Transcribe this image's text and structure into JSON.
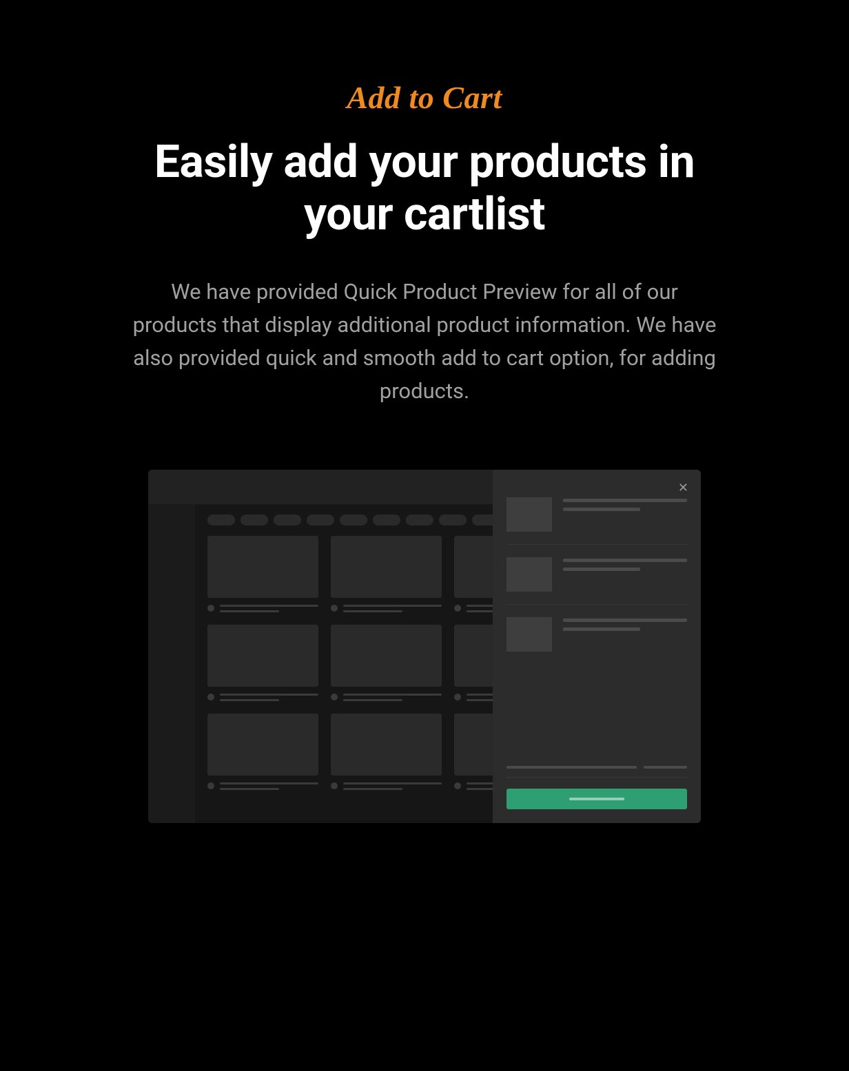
{
  "hero": {
    "eyebrow": "Add to Cart",
    "headline": "Easily add your products in your cartlist",
    "description": "We have provided Quick Product Preview for all of our products that display additional product information. We have also provided quick and smooth add to cart option, for adding products."
  },
  "colors": {
    "accent": "#ee8a1f",
    "cta": "#2d9f72",
    "bg": "#000000"
  }
}
